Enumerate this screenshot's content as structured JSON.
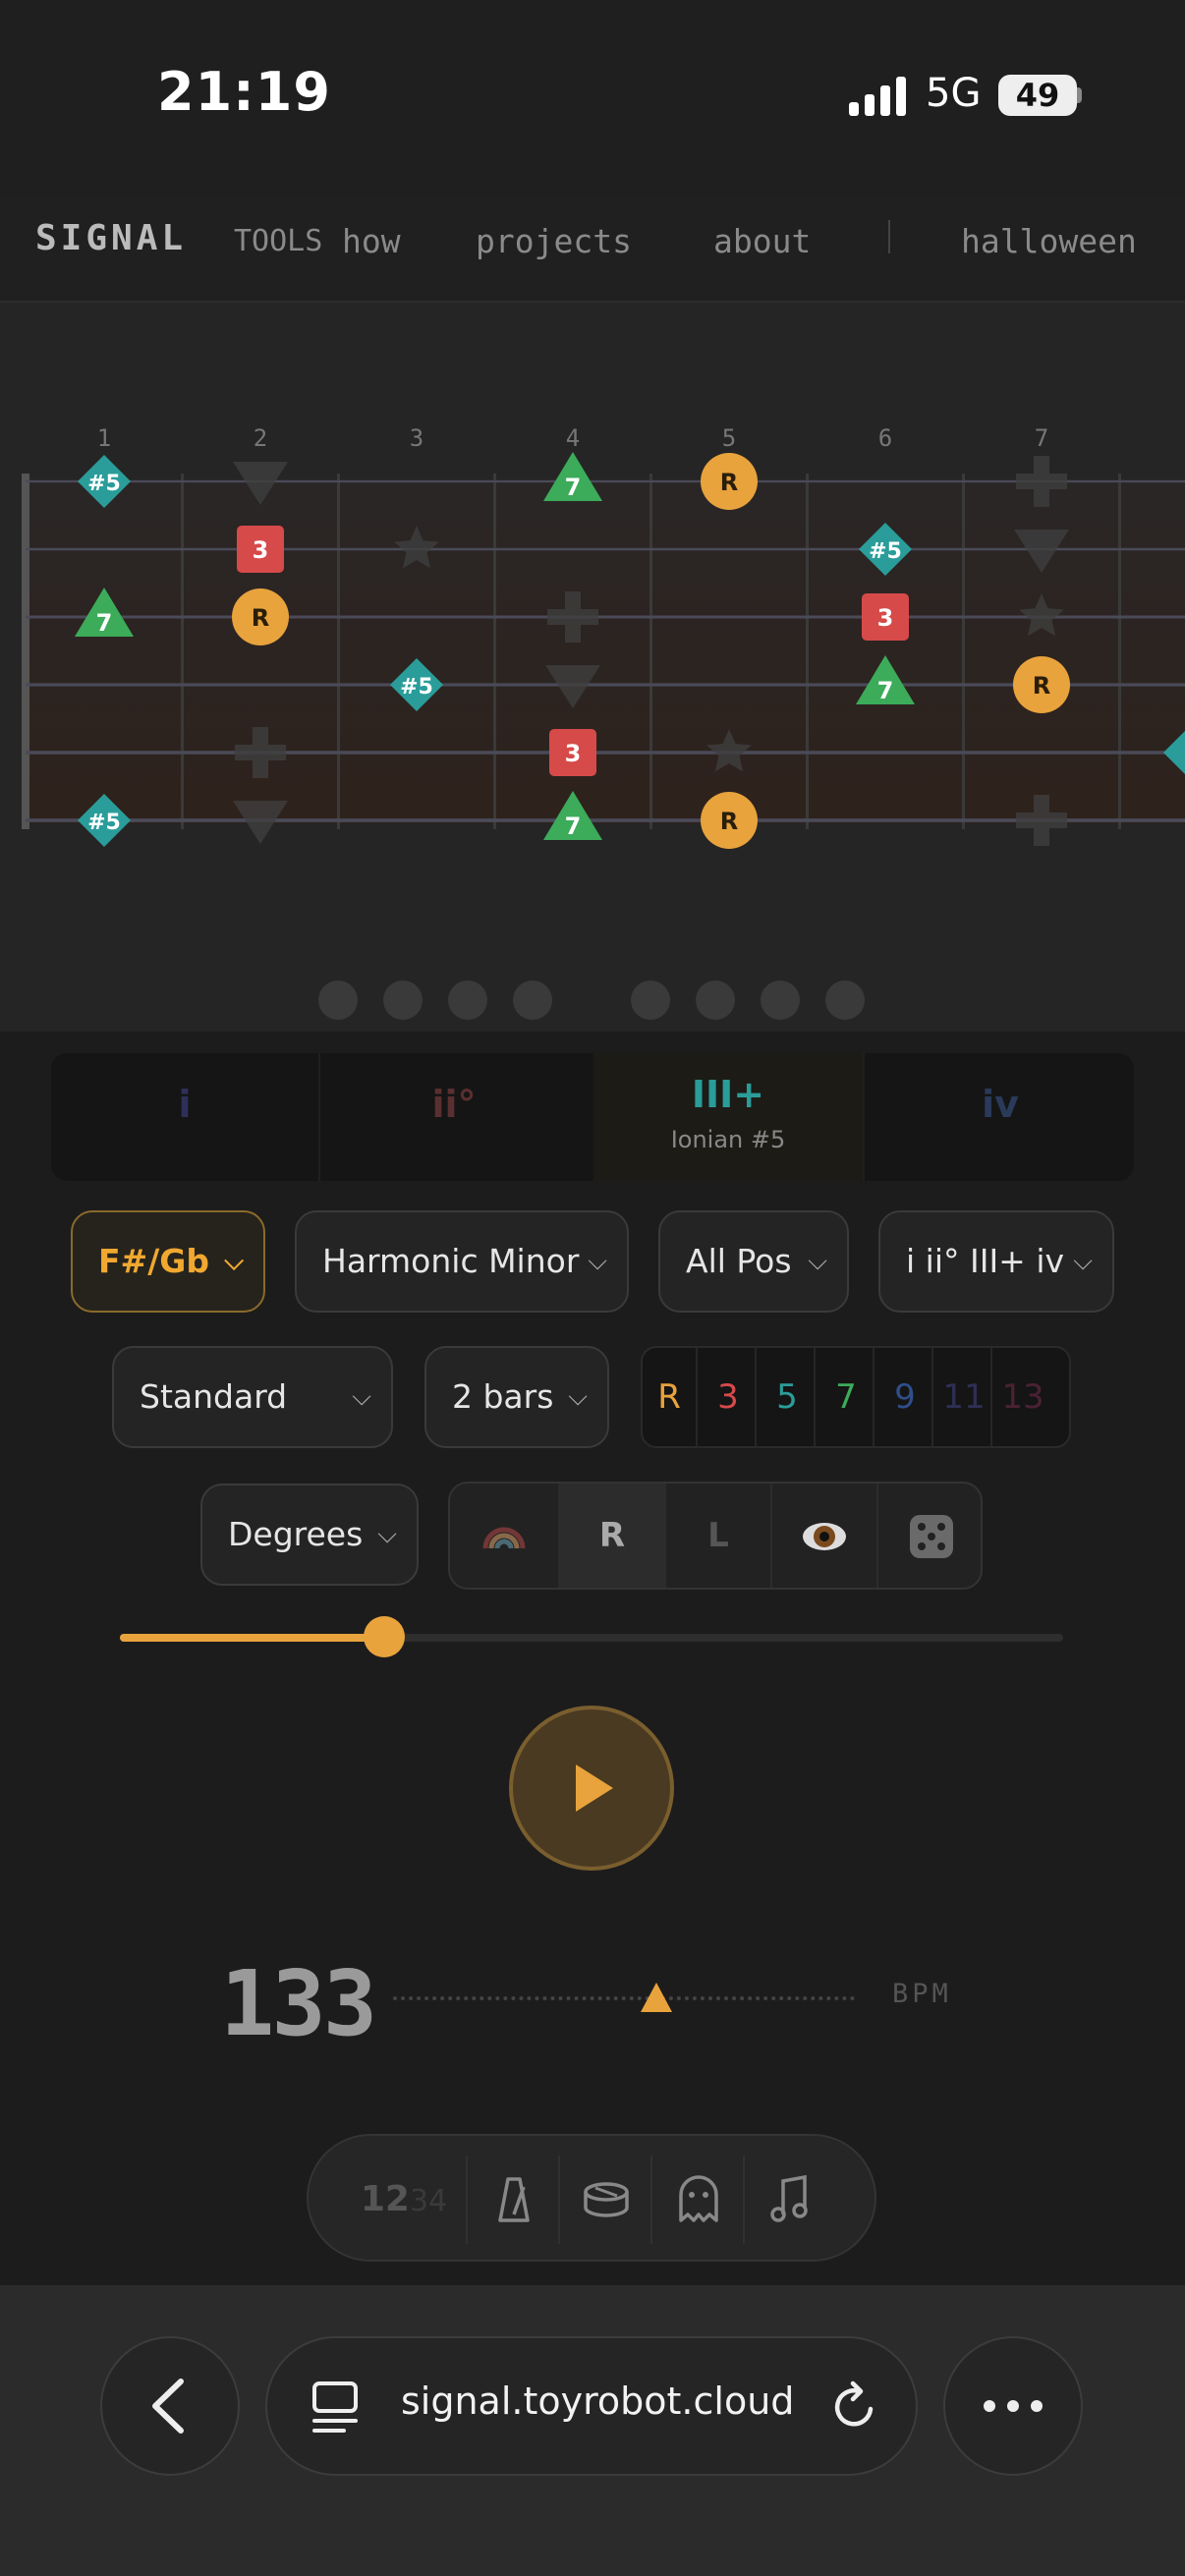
{
  "status": {
    "time": "21:19",
    "network": "5G",
    "battery": "49"
  },
  "nav": {
    "brand": "SIGNAL",
    "tools": "TOOLS",
    "how": "how",
    "projects": "projects",
    "about": "about",
    "halloween": "halloween"
  },
  "fretboard": {
    "fret_numbers": [
      "1",
      "2",
      "3",
      "4",
      "5",
      "6",
      "7"
    ],
    "notes": [
      {
        "fret": 1,
        "string": 1,
        "label": "#5",
        "shape": "diamond",
        "color": "#2a9d9a"
      },
      {
        "fret": 4,
        "string": 1,
        "label": "7",
        "shape": "triangle",
        "color": "#3cab5a"
      },
      {
        "fret": 5,
        "string": 1,
        "label": "R",
        "shape": "circle",
        "color": "#e8a33c"
      },
      {
        "fret": 2,
        "string": 2,
        "label": "3",
        "shape": "square",
        "color": "#d64a4a"
      },
      {
        "fret": 6,
        "string": 2,
        "label": "#5",
        "shape": "diamond",
        "color": "#2a9d9a"
      },
      {
        "fret": 1,
        "string": 3,
        "label": "7",
        "shape": "triangle",
        "color": "#3cab5a"
      },
      {
        "fret": 2,
        "string": 3,
        "label": "R",
        "shape": "circle",
        "color": "#e8a33c"
      },
      {
        "fret": 6,
        "string": 3,
        "label": "3",
        "shape": "square",
        "color": "#d64a4a"
      },
      {
        "fret": 3,
        "string": 4,
        "label": "#5",
        "shape": "diamond",
        "color": "#2a9d9a"
      },
      {
        "fret": 6,
        "string": 4,
        "label": "7",
        "shape": "triangle",
        "color": "#3cab5a"
      },
      {
        "fret": 7,
        "string": 4,
        "label": "R",
        "shape": "circle",
        "color": "#e8a33c"
      },
      {
        "fret": 4,
        "string": 5,
        "label": "3",
        "shape": "square",
        "color": "#d64a4a"
      },
      {
        "fret": 1,
        "string": 6,
        "label": "#5",
        "shape": "diamond",
        "color": "#2a9d9a"
      },
      {
        "fret": 4,
        "string": 6,
        "label": "7",
        "shape": "triangle",
        "color": "#3cab5a"
      },
      {
        "fret": 5,
        "string": 6,
        "label": "R",
        "shape": "circle",
        "color": "#e8a33c"
      }
    ]
  },
  "degree_tabs": [
    {
      "label": "i",
      "sub": "",
      "color": "#2f2f5a"
    },
    {
      "label": "ii°",
      "sub": "",
      "color": "#5a2f2f"
    },
    {
      "label": "III+",
      "sub": "Ionian #5",
      "color": "#2a9d9a"
    },
    {
      "label": "iv",
      "sub": "",
      "color": "#2a3a5a"
    }
  ],
  "controls": {
    "key": "F#/Gb",
    "scale": "Harmonic Minor",
    "position": "All Pos",
    "progression": "i ii° III+ iv",
    "tuning": "Standard",
    "bars": "2 bars",
    "intervals": [
      {
        "label": "R",
        "color": "#e8a33c"
      },
      {
        "label": "3",
        "color": "#d64a4a"
      },
      {
        "label": "5",
        "color": "#2a9d9a"
      },
      {
        "label": "7",
        "color": "#3cab5a"
      },
      {
        "label": "9",
        "color": "#2f4f8a"
      },
      {
        "label": "11",
        "color": "#2f2f55"
      },
      {
        "label": "13",
        "color": "#4a2233"
      }
    ],
    "label_mode": "Degrees",
    "toggles": [
      "R",
      "L"
    ],
    "accent": "#e8a33c",
    "slider_fraction": 0.28
  },
  "tempo": {
    "bpm": "133",
    "unit": "BPM"
  },
  "pill": {
    "count": "12",
    "count_dim": "34"
  },
  "browser": {
    "url": "signal.toyrobot.cloud"
  }
}
